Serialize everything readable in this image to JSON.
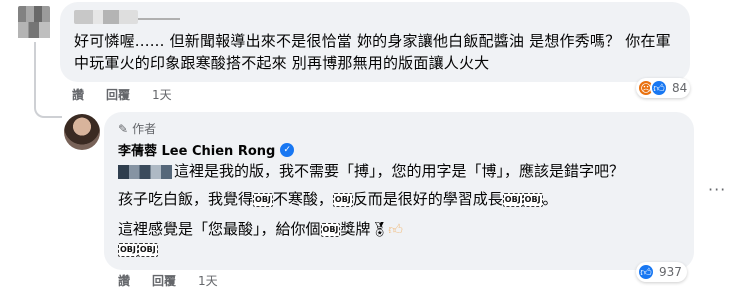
{
  "comment": {
    "text": "好可憐喔...... 但新聞報導出來不是很恰當 妳的身家讓他白飯配醬油 是想作秀嗎？ 你在軍中玩軍火的印象跟寒酸搭不起來 別再博那無用的版面讓人火大",
    "actions": {
      "like": "讚",
      "reply": "回覆",
      "time": "1天"
    },
    "reaction_count": "84",
    "reaction_icons": [
      "angry-icon",
      "like-icon"
    ]
  },
  "reply": {
    "badge": "作者",
    "author": "李蒨蓉 Lee Chien Rong",
    "line1": "這裡是我的版，我不需要「搏」，您的用字是「博」，應該是錯字吧？",
    "line2_a": "孩子吃白飯，我覺得",
    "line2_b": "不寒酸，",
    "line2_c": "反而是很好的學習成長",
    "line2_d": "。",
    "line3_a": "這裡感覺是「您最酸」，給你個",
    "line3_b": "獎牌",
    "obj": "OBJ",
    "actions": {
      "like": "讚",
      "reply": "回覆",
      "time": "1天"
    },
    "reaction_count": "937",
    "reaction_icons": [
      "like-icon"
    ]
  },
  "colors": {
    "bubble": "#f0f2f5",
    "meta": "#65676b",
    "like_blue": "#1877f2",
    "angry_orange": "#e9710f"
  }
}
